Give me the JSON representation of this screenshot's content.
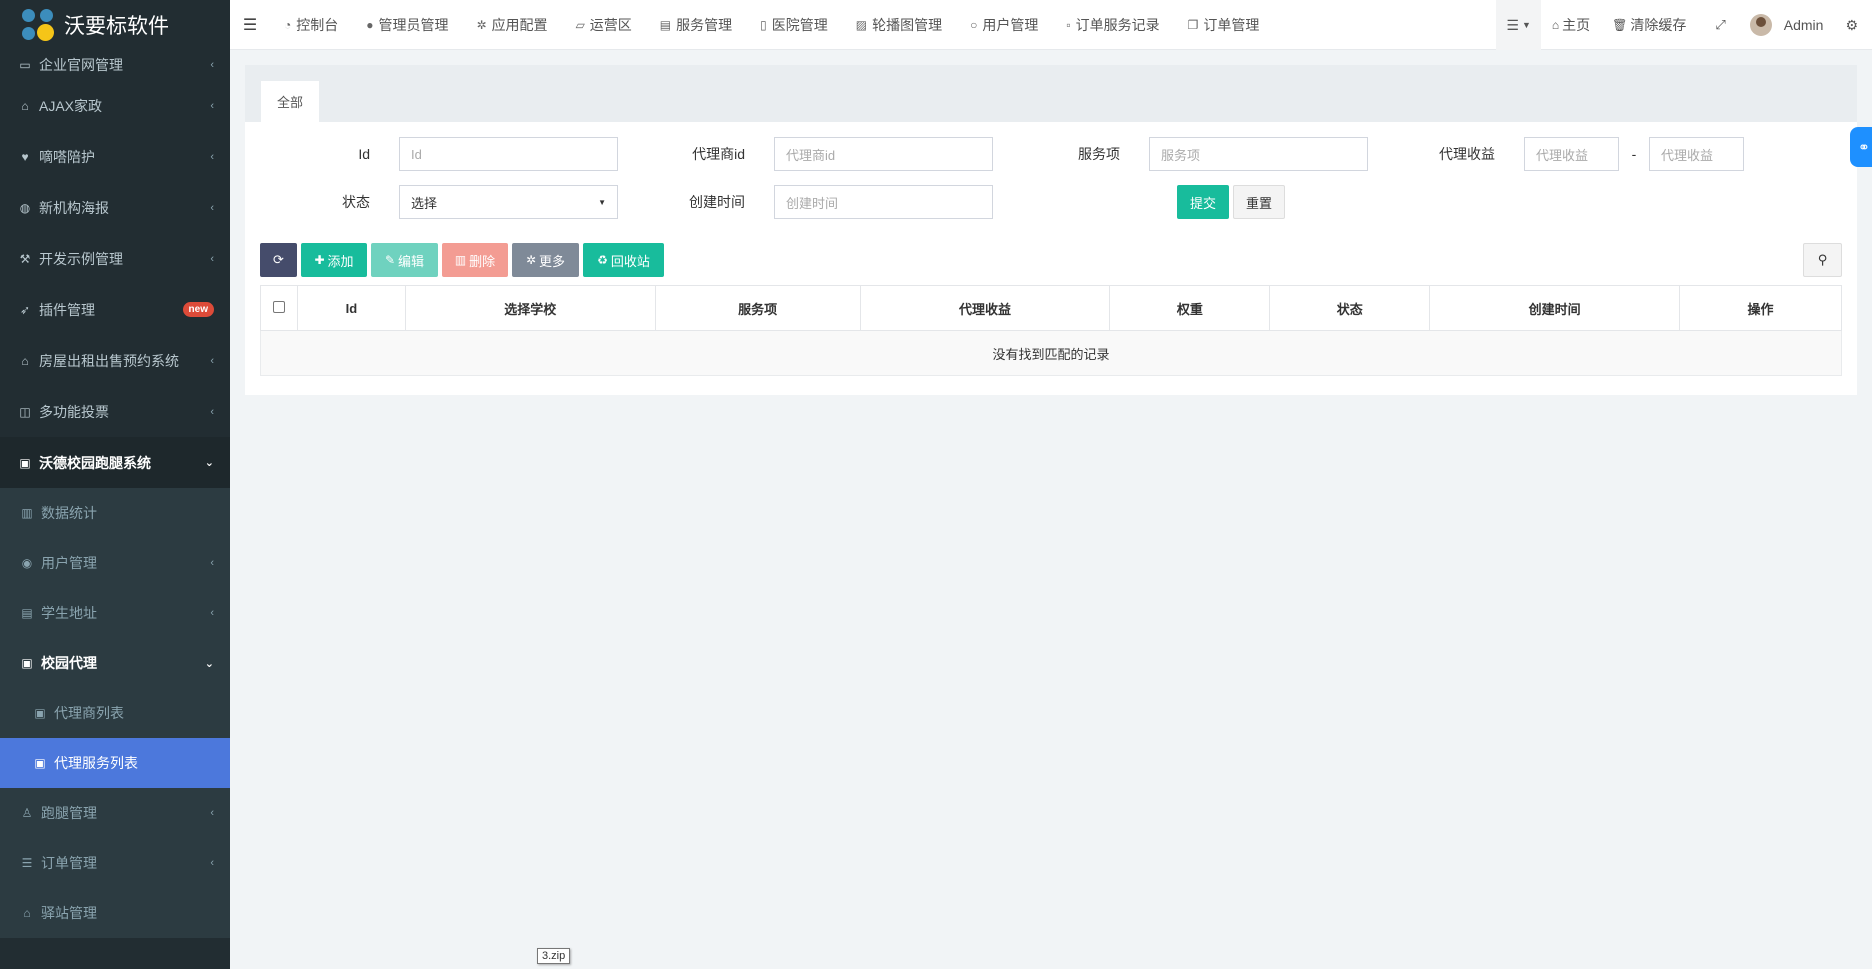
{
  "brand": {
    "name": "沃要标软件"
  },
  "sidebar": {
    "items": [
      {
        "label": "企业官网管理",
        "icon": "monitor-icon",
        "glyph": "▭"
      },
      {
        "label": "AJAX家政",
        "icon": "home-icon",
        "glyph": "⌂"
      },
      {
        "label": "嘀嗒陪护",
        "icon": "heartbeat-icon",
        "glyph": "♥"
      },
      {
        "label": "新机构海报",
        "icon": "globe-icon",
        "glyph": "◍"
      },
      {
        "label": "开发示例管理",
        "icon": "magic-wand-icon",
        "glyph": "⚒"
      },
      {
        "label": "插件管理",
        "icon": "rocket-icon",
        "glyph": "➶",
        "badge": "new"
      },
      {
        "label": "房屋出租出售预约系统",
        "icon": "home-icon",
        "glyph": "⌂"
      },
      {
        "label": "多功能投票",
        "icon": "columns-icon",
        "glyph": "◫"
      },
      {
        "label": "沃德校园跑腿系统",
        "icon": "lock-icon",
        "glyph": "🔒"
      }
    ],
    "sub_items": [
      {
        "label": "数据统计",
        "icon": "bar-chart-icon",
        "glyph": "▥"
      },
      {
        "label": "用户管理",
        "icon": "user-circle-icon",
        "glyph": "◉"
      },
      {
        "label": "学生地址",
        "icon": "address-card-icon",
        "glyph": "▤"
      },
      {
        "label": "校园代理",
        "icon": "id-badge-icon",
        "glyph": "▣"
      }
    ],
    "subsub_items": [
      {
        "label": "代理商列表",
        "icon": "id-badge-icon",
        "glyph": "▣"
      },
      {
        "label": "代理服务列表",
        "icon": "id-badge-icon",
        "glyph": "▣"
      }
    ],
    "bottom_items": [
      {
        "label": "跑腿管理",
        "icon": "user-run-icon",
        "glyph": "♙"
      },
      {
        "label": "订单管理",
        "icon": "list-icon",
        "glyph": "☰"
      },
      {
        "label": "驿站管理",
        "icon": "home-icon",
        "glyph": "⌂"
      }
    ]
  },
  "topnav": {
    "items": [
      {
        "label": "控制台",
        "icon": "dashboard-icon",
        "glyph": "◔"
      },
      {
        "label": "管理员管理",
        "icon": "user-icon",
        "glyph": "●"
      },
      {
        "label": "应用配置",
        "icon": "gear-icon",
        "glyph": "✲"
      },
      {
        "label": "运营区",
        "icon": "map-icon",
        "glyph": "▱"
      },
      {
        "label": "服务管理",
        "icon": "list-alt-icon",
        "glyph": "▤"
      },
      {
        "label": "医院管理",
        "icon": "clipboard-icon",
        "glyph": "▯"
      },
      {
        "label": "轮播图管理",
        "icon": "image-icon",
        "glyph": "▨"
      },
      {
        "label": "用户管理",
        "icon": "user-outline-icon",
        "glyph": "○"
      },
      {
        "label": "订单服务记录",
        "icon": "save-icon",
        "glyph": "▫"
      },
      {
        "label": "订单管理",
        "icon": "copy-icon",
        "glyph": "❐"
      }
    ],
    "right": {
      "home": "主页",
      "clear_cache": "清除缓存",
      "user": "Admin"
    }
  },
  "panel": {
    "tab_all": "全部",
    "filters": {
      "id_label": "Id",
      "id_placeholder": "Id",
      "agent_id_label": "代理商id",
      "agent_id_placeholder": "代理商id",
      "service_label": "服务项",
      "service_placeholder": "服务项",
      "income_label": "代理收益",
      "income_min_placeholder": "代理收益",
      "income_sep": "-",
      "income_max_placeholder": "代理收益",
      "status_label": "状态",
      "status_value": "选择",
      "created_label": "创建时间",
      "created_placeholder": "创建时间",
      "submit": "提交",
      "reset": "重置"
    },
    "toolbar": {
      "add": "添加",
      "edit": "编辑",
      "delete": "删除",
      "more": "更多",
      "recycle": "回收站"
    },
    "table": {
      "columns": [
        "Id",
        "选择学校",
        "服务项",
        "代理收益",
        "权重",
        "状态",
        "创建时间",
        "操作"
      ],
      "empty_text": "没有找到匹配的记录"
    }
  },
  "tooltip": {
    "text": "3.zip"
  },
  "colors": {
    "sidebar_bg": "#222d32",
    "active": "#4c78dc",
    "teal": "#18bc9c",
    "danger": "#f39c93",
    "dark_btn": "#454c6b"
  }
}
